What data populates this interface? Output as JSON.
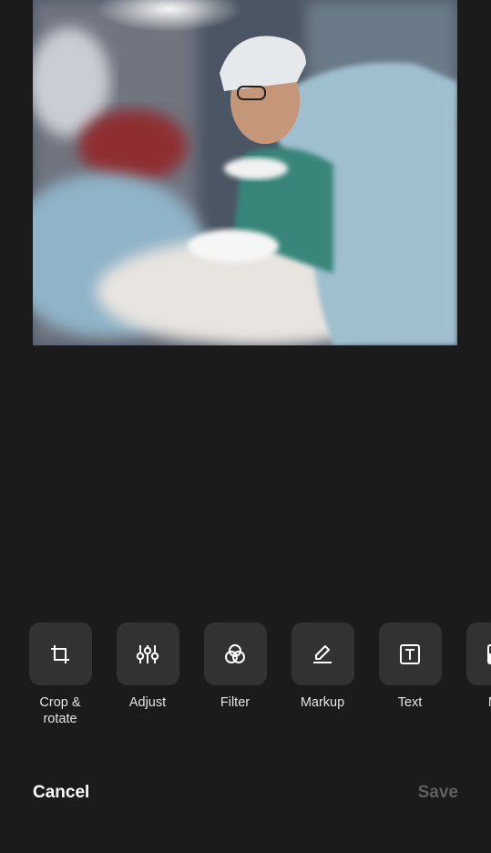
{
  "photo": {
    "subject": "surgeons in operating room"
  },
  "tools": [
    {
      "label": "Crop &\nrotate",
      "icon": "crop-rotate-icon"
    },
    {
      "label": "Adjust",
      "icon": "sliders-icon"
    },
    {
      "label": "Filter",
      "icon": "filter-circles-icon"
    },
    {
      "label": "Markup",
      "icon": "pen-markup-icon"
    },
    {
      "label": "Text",
      "icon": "text-box-icon"
    },
    {
      "label": "Mo",
      "icon": "more-icon"
    }
  ],
  "actions": {
    "cancel": "Cancel",
    "save": "Save"
  },
  "colors": {
    "background": "#1b1b1b",
    "tile": "#323232",
    "save_disabled": "#5f5f5f"
  }
}
